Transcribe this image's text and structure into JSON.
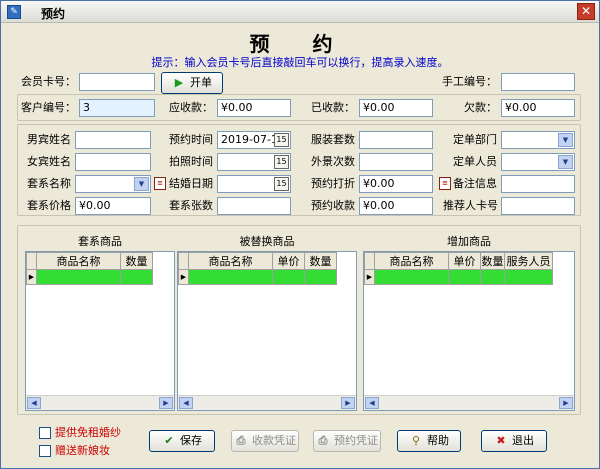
{
  "window": {
    "title": "预约"
  },
  "header": {
    "title": "预 约",
    "hint": "提示：输入会员卡号后直接敲回车可以换行，提高录入速度。"
  },
  "top_row": {
    "member_card_label": "会员卡号：",
    "member_card_value": "",
    "open_order_label": "开单",
    "manual_no_label": "手工编号：",
    "manual_no_value": ""
  },
  "summary": {
    "customer_no_label": "客户编号：",
    "customer_no_value": "3",
    "receivable_label": "应收款：",
    "receivable_value": "¥0.00",
    "received_label": "已收款：",
    "received_value": "¥0.00",
    "owed_label": "欠款：",
    "owed_value": "¥0.00"
  },
  "form": {
    "groom_name_label": "男宾姓名",
    "groom_name_value": "",
    "appointment_time_label": "预约时间",
    "appointment_time_value": "2019-07-11",
    "costume_count_label": "服装套数",
    "costume_count_value": "",
    "order_dept_label": "定单部门",
    "order_dept_value": "",
    "bride_name_label": "女宾姓名",
    "bride_name_value": "",
    "photo_time_label": "拍照时间",
    "photo_time_value": "",
    "outdoor_count_label": "外景次数",
    "outdoor_count_value": "",
    "order_person_label": "定单人员",
    "order_person_value": "",
    "package_name_label": "套系名称",
    "package_name_value": "",
    "wedding_date_label": "结婚日期",
    "wedding_date_value": "",
    "booking_discount_label": "预约打折",
    "booking_discount_value": "¥0.00",
    "remarks_label": "备注信息",
    "remarks_value": "",
    "package_price_label": "套系价格",
    "package_price_value": "¥0.00",
    "package_sheets_label": "套系张数",
    "package_sheets_value": "",
    "booking_payment_label": "预约收款",
    "booking_payment_value": "¥0.00",
    "referrer_card_label": "推荐人卡号",
    "referrer_card_value": ""
  },
  "grids": {
    "package_items": {
      "title": "套系商品",
      "columns": [
        "商品名称",
        "数量"
      ]
    },
    "replaced_items": {
      "title": "被替换商品",
      "columns": [
        "商品名称",
        "单价",
        "数量"
      ]
    },
    "added_items": {
      "title": "增加商品",
      "columns": [
        "商品名称",
        "单价",
        "数量",
        "服务人员"
      ]
    }
  },
  "footer": {
    "free_dress_label": "提供免租婚纱",
    "gift_bridal_makeup_label": "赠送新娘妆",
    "save_label": "保存",
    "payment_voucher_label": "收款凭证",
    "booking_voucher_label": "预约凭证",
    "help_label": "帮助",
    "exit_label": "退出"
  },
  "colors": {
    "row_highlight": "#33dd33",
    "hint_text": "#0000cc",
    "checkbox_label": "#cc0000"
  }
}
